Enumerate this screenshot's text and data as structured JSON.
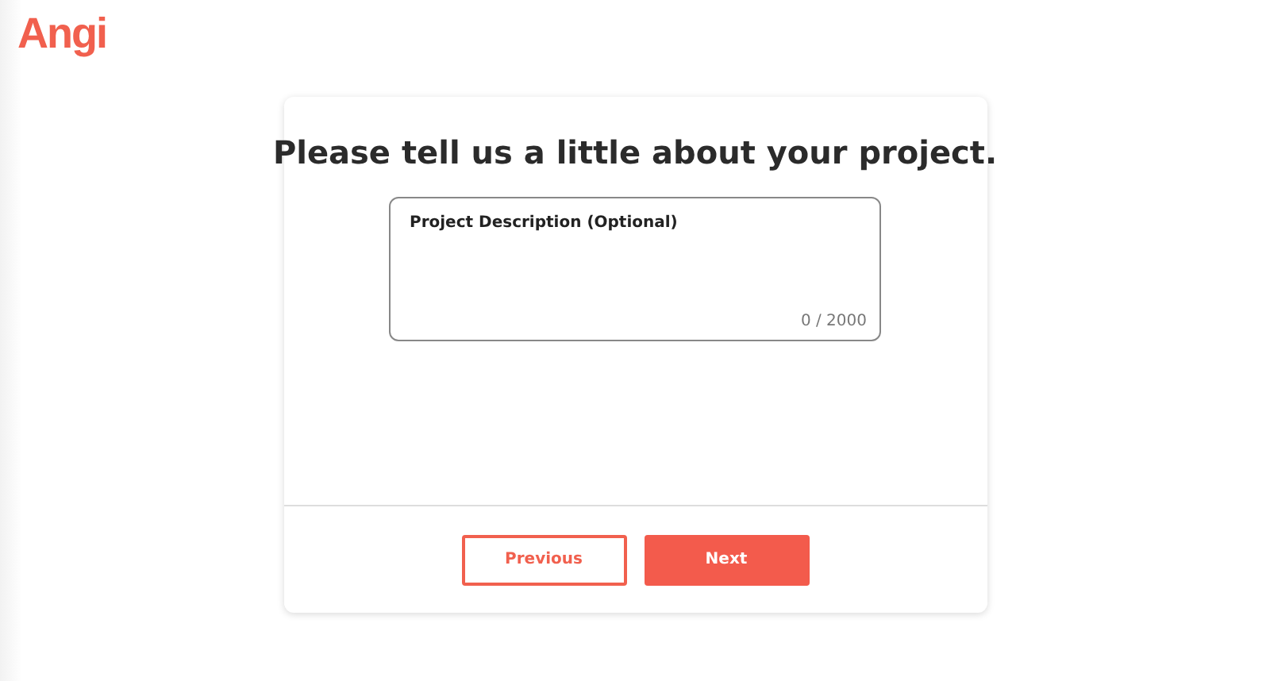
{
  "logo": "Angi",
  "card": {
    "title": "Please tell us a little about your project.",
    "description_field": {
      "label": "Project Description (Optional)",
      "counter": "0 / 2000"
    },
    "buttons": [
      {
        "label": "Previous",
        "kind": "secondary"
      },
      {
        "label": "Next",
        "kind": "primary"
      }
    ]
  }
}
